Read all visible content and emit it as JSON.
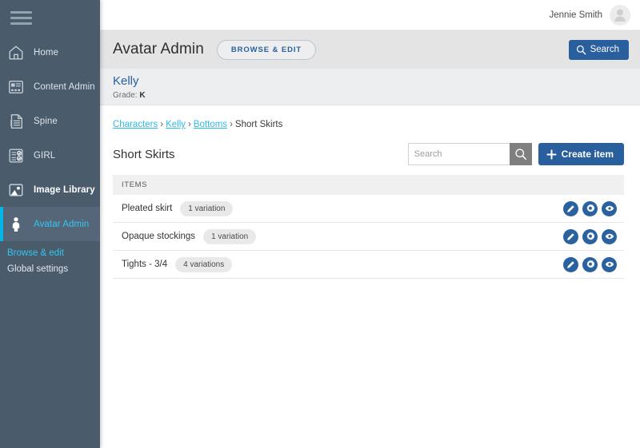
{
  "sidebar": {
    "menu_icon": "hamburger-icon",
    "items": [
      {
        "label": "Home",
        "icon": "home-icon",
        "active": false,
        "bold": false
      },
      {
        "label": "Content Admin",
        "icon": "content-admin-icon",
        "active": false,
        "bold": false
      },
      {
        "label": "Spine",
        "icon": "document-icon",
        "active": false,
        "bold": false
      },
      {
        "label": "GIRL",
        "icon": "checklist-icon",
        "active": false,
        "bold": false
      },
      {
        "label": "Image Library",
        "icon": "image-library-icon",
        "active": false,
        "bold": true
      },
      {
        "label": "Avatar Admin",
        "icon": "person-icon",
        "active": true,
        "bold": false
      }
    ],
    "subitems": [
      {
        "label": "Browse & edit",
        "active": true
      },
      {
        "label": "Global settings",
        "active": false
      }
    ],
    "accent_color": "#00b7e8",
    "background_color": "#4a5b6b"
  },
  "topbar": {
    "user_name": "Jennie Smith",
    "avatar_icon": "user-avatar-icon"
  },
  "titlebar": {
    "app_title": "Avatar Admin",
    "browse_edit_label": "BROWSE & EDIT",
    "search_label": "Search",
    "search_icon": "search-icon"
  },
  "character": {
    "name": "Kelly",
    "grade_label": "Grade:",
    "grade_value": "K"
  },
  "breadcrumb": {
    "items": [
      {
        "label": "Characters",
        "link": true
      },
      {
        "label": "Kelly",
        "link": true
      },
      {
        "label": "Bottoms",
        "link": true
      },
      {
        "label": "Short Skirts",
        "link": false
      }
    ],
    "separator": "›"
  },
  "toolbar": {
    "page_title": "Short Skirts",
    "search_placeholder": "Search",
    "search_value": "",
    "search_icon": "magnifier-icon",
    "create_label": "Create item",
    "create_icon": "plus-icon"
  },
  "list": {
    "header": "ITEMS",
    "rows": [
      {
        "name": "Pleated skirt",
        "badge": "1 variation"
      },
      {
        "name": "Opaque stockings",
        "badge": "1 variation"
      },
      {
        "name": "Tights - 3/4",
        "badge": "4 variations"
      }
    ],
    "actions": [
      {
        "name": "edit",
        "icon": "pencil-icon"
      },
      {
        "name": "settings",
        "icon": "gear-icon"
      },
      {
        "name": "preview",
        "icon": "eye-icon"
      }
    ]
  },
  "colors": {
    "primary_blue": "#2a5f9e",
    "link_cyan": "#2bbbe8",
    "action_blue": "#2a62a0"
  }
}
